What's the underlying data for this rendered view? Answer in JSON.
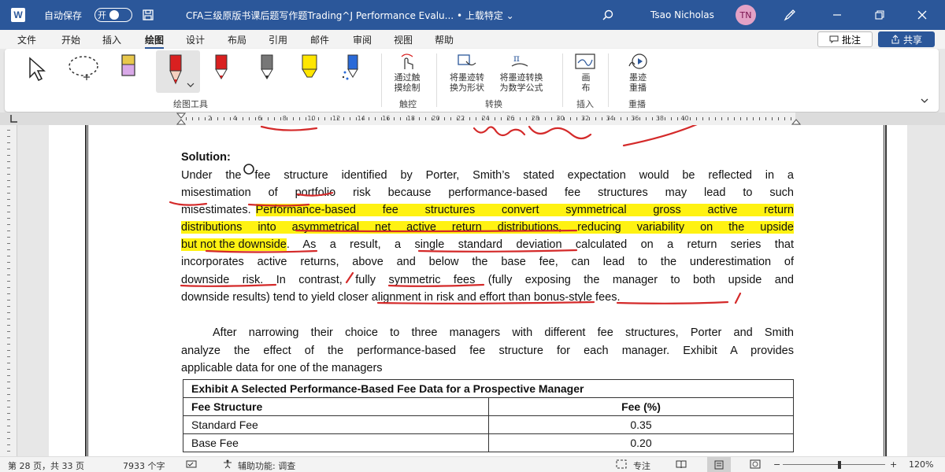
{
  "titlebar": {
    "app_icon": "W",
    "autosave_label": "自动保存",
    "autosave_state": "开",
    "doc_title": "CFA三级原版书课后题写作题Trading^J Performance Evalu...",
    "upload_status": "• 上载特定 ⌄",
    "user_name": "Tsao Nicholas",
    "user_initials": "TN",
    "accent_color": "#2b579a"
  },
  "menu": {
    "items": [
      "文件",
      "开始",
      "插入",
      "绘图",
      "设计",
      "布局",
      "引用",
      "邮件",
      "审阅",
      "视图",
      "帮助"
    ],
    "active": "绘图",
    "comment_label": "批注",
    "share_label": "共享"
  },
  "ribbon": {
    "drawing_tools_label": "绘图工具",
    "touch_draw_label_1": "通过触",
    "touch_draw_label_2": "摸绘制",
    "touch_group_label": "触控",
    "ink_to_shape_1": "将墨迹转",
    "ink_to_shape_2": "换为形状",
    "ink_to_math_1": "将墨迹转换",
    "ink_to_math_2": "为数学公式",
    "convert_group_label": "转换",
    "canvas_1": "画",
    "canvas_2": "布",
    "insert_group_label": "插入",
    "replay_1": "墨迹",
    "replay_2": "重播",
    "replay_group_label": "重播",
    "pen_colors": [
      "#e8c84c",
      "#d92020",
      "#d92020",
      "#777777",
      "#ffe600",
      "#2a6ad8"
    ]
  },
  "ruler": {
    "ticks": [
      "2",
      "4",
      "6",
      "8",
      "10",
      "12",
      "14",
      "16",
      "18",
      "20",
      "22",
      "24",
      "26",
      "28",
      "30",
      "32",
      "34",
      "36",
      "38",
      "40"
    ]
  },
  "document": {
    "solution_heading": "Solution:",
    "lines": [
      "Under the fee structure identified by Porter, Smith’s stated expectation would be reflected in a",
      "misestimation of portfolio risk because performance-based fee structures may lead to such",
      "misestimates.",
      "Performance-based fee structures convert symmetrical gross active return",
      "distributions into asymmetrical net active return distributions, reducing variability on the upside",
      "but not the downside",
      ". As a result, a single standard deviation calculated on a return series that",
      "incorporates active returns, above and below the base fee, can lead to the underestimation of",
      "downside risk. In contrast, fully symmetric fees (fully exposing the manager to both upside and",
      "downside results) tend to yield closer alignment in risk and effort than bonus-style fees."
    ],
    "para2": [
      "After narrowing their choice to three managers with different fee structures, Porter and Smith",
      "analyze the effect of the performance-based fee structure for each manager. Exhibit A provides",
      "applicable data for one of the managers"
    ],
    "highlight_color": "#fff212",
    "ink_color": "#d42a2a"
  },
  "exhibit": {
    "title": "Exhibit A Selected Performance-Based Fee Data for a Prospective Manager",
    "col1": "Fee Structure",
    "col2": "Fee (%)",
    "rows": [
      {
        "label": "Standard Fee",
        "value": "0.35"
      },
      {
        "label": "Base Fee",
        "value": "0.20"
      }
    ]
  },
  "statusbar": {
    "page_info": "第 28 页，共 33 页",
    "word_count": "7933 个字",
    "accessibility": "辅助功能: 调查",
    "focus": "专注",
    "zoom": "120%"
  }
}
